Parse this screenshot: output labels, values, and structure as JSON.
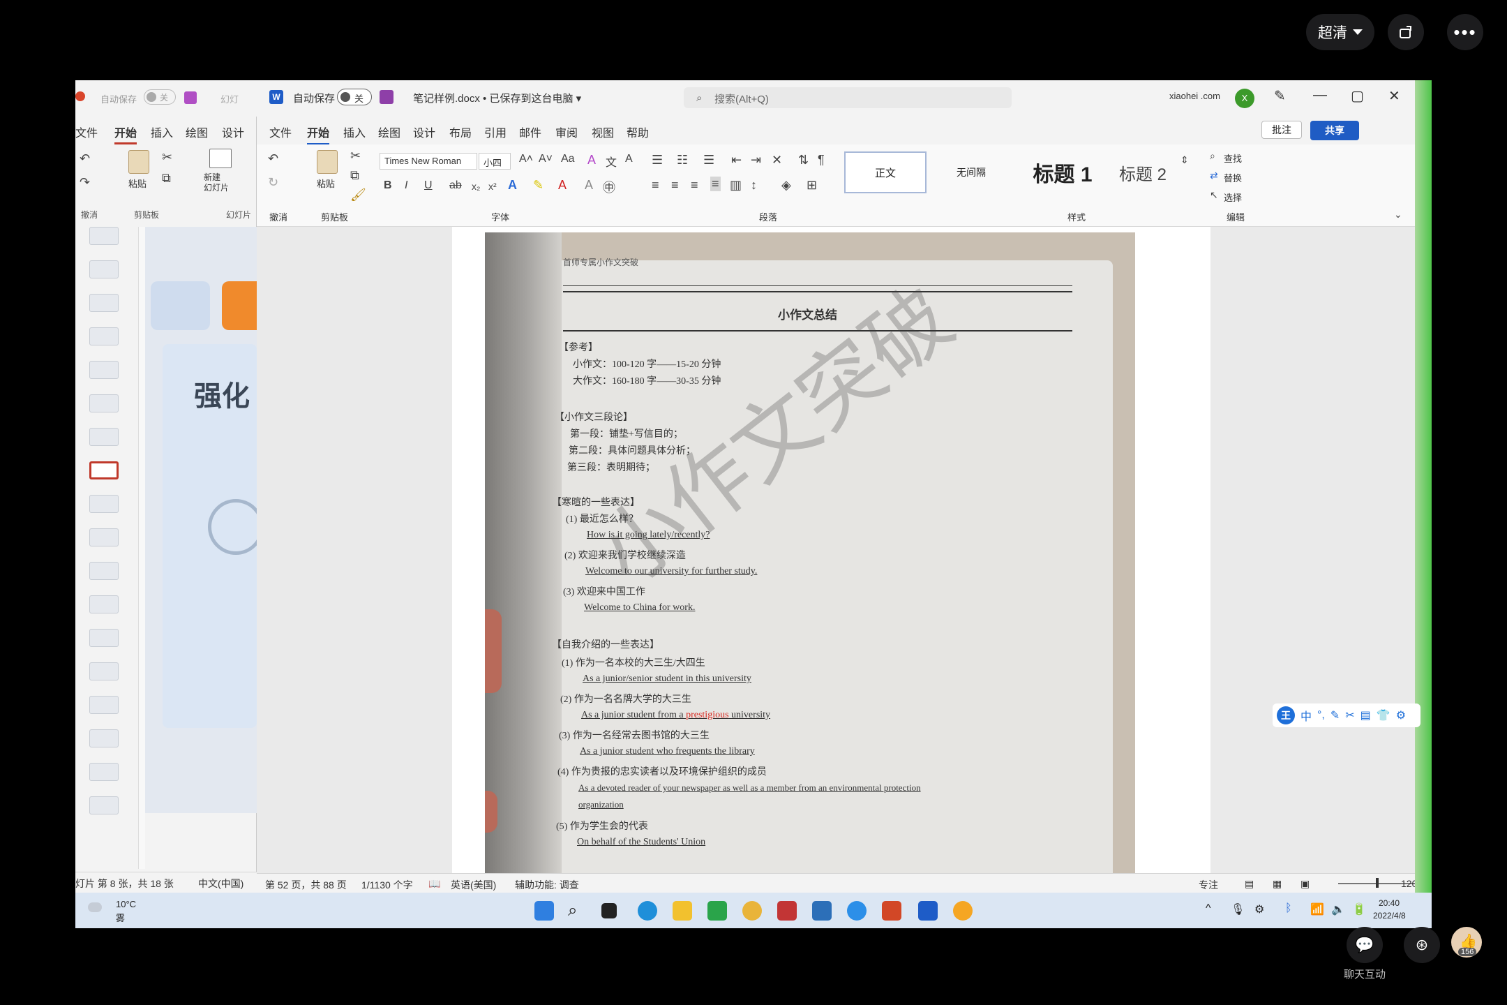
{
  "player": {
    "quality_label": "超清",
    "more_label": "•••",
    "chat_label": "聊天互动",
    "likes_count": "156"
  },
  "ppt": {
    "tabs": [
      "文件",
      "开始",
      "插入",
      "绘图",
      "设计"
    ],
    "ribbon_labels": [
      "粘贴",
      "新建\n幻灯片",
      "撤消",
      "剪贴板",
      "幻灯片"
    ],
    "slide_title": "强化",
    "status_left": "灯片 第 8 张，共 18 张",
    "status_lang": "中文(中国)",
    "autosave_label": "自动保存",
    "toggle_label": "关",
    "app_label": "幻灯"
  },
  "word": {
    "autosave_label": "自动保存",
    "toggle_label": "关",
    "doc_title": "笔记样例.docx • 已保存到这台电脑 ▾",
    "search_placeholder": "搜索(Alt+Q)",
    "user_name": "xiaohei .com",
    "avatar_initial": "X",
    "tabs": [
      "文件",
      "开始",
      "插入",
      "绘图",
      "设计",
      "布局",
      "引用",
      "邮件",
      "审阅",
      "视图",
      "帮助"
    ],
    "comment_label": "批注",
    "share_label": "共享",
    "ribbon": {
      "undo_group": "撤消",
      "clipboard_group": "剪贴板",
      "paste_label": "粘贴",
      "font_group": "字体",
      "paragraph_group": "段落",
      "styles_group": "样式",
      "editing_group": "编辑",
      "font_name": "Times New Roman",
      "font_size": "小四",
      "styles": [
        "正文",
        "无间隔",
        "标题 1",
        "标题 2"
      ],
      "find_label": "查找",
      "replace_label": "替换",
      "select_label": "选择"
    },
    "status": {
      "page": "第 52 页，共 88 页",
      "words": "1/1130 个字",
      "lang": "英语(美国)",
      "accessibility": "辅助功能: 调查",
      "focus": "专注",
      "zoom": "120%"
    }
  },
  "scan": {
    "header": "首师专属小作文突破",
    "title": "小作文总结",
    "sec1": "【参考】",
    "l1": "小作文：100-120 字——15-20 分钟",
    "l2": "大作文：160-180 字——30-35 分钟",
    "sec2": "【小作文三段论】",
    "p1": "第一段：铺垫+写信目的；",
    "p2": "第二段：具体问题具体分析；",
    "p3": "第三段：表明期待；",
    "sec3": "【寒暄的一些表达】",
    "q1": "(1) 最近怎么样？",
    "a1": "How is it going lately/recently?",
    "q2": "(2) 欢迎来我们学校继续深造",
    "a2": "Welcome to our university for further study.",
    "q3": "(3) 欢迎来中国工作",
    "a3": "Welcome to China for work.",
    "sec4": "【自我介绍的一些表达】",
    "s1": "(1) 作为一名本校的大三生/大四生",
    "s1a": "As a junior/senior student in this university",
    "s2": "(2) 作为一名名牌大学的大三生",
    "s2a_pre": "As a junior student from a ",
    "s2a_hl": "prestigious",
    "s2a_post": " university",
    "s3": "(3) 作为一名经常去图书馆的大三生",
    "s3a": "As a junior student who frequents the library",
    "s4": "(4) 作为贵报的忠实读者以及环境保护组织的成员",
    "s4a": "As a devoted reader of your newspaper as well as a member from an environmental protection",
    "s4b": "organization",
    "s5": "(5) 作为学生会的代表",
    "s5a": "On behalf of the Students' Union",
    "watermark": "小作文突破"
  },
  "ime": {
    "logo": "王",
    "items": [
      "中",
      "°,",
      "✎",
      "✂",
      "▤",
      "👕",
      "⚙"
    ]
  },
  "taskbar": {
    "weather_temp": "10°C",
    "weather_desc": "雾",
    "time": "20:40",
    "date": "2022/4/8"
  }
}
